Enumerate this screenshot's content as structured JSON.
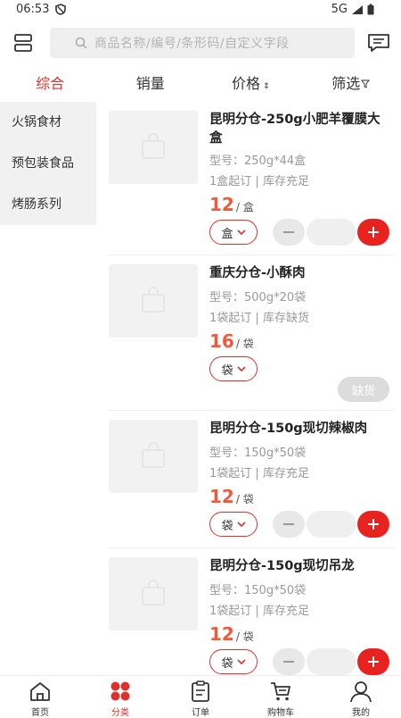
{
  "status": {
    "time": "06:53",
    "network": "5G"
  },
  "search": {
    "placeholder": "商品名称/编号/条形码/自定义字段"
  },
  "sort_tabs": [
    "综合",
    "销量",
    "价格",
    "筛选"
  ],
  "sidebar": {
    "items": [
      "火锅食材",
      "预包装食品",
      "烤肠系列"
    ]
  },
  "products": [
    {
      "title": "昆明分仓-250g小肥羊覆膜大盒",
      "spec": "型号：250g*44盒",
      "moq": "1盒起订",
      "stock": "库存充足",
      "price": "12",
      "unit": "/ 盒",
      "unit_select": "盒",
      "out_of_stock": false
    },
    {
      "title": "重庆分仓-小酥肉",
      "spec": "型号：500g*20袋",
      "moq": "1袋起订",
      "stock": "库存缺货",
      "price": "16",
      "unit": "/ 袋",
      "unit_select": "袋",
      "out_of_stock": true,
      "oos_label": "缺货"
    },
    {
      "title": "昆明分仓-150g现切辣椒肉",
      "spec": "型号：150g*50袋",
      "moq": "1袋起订",
      "stock": "库存充足",
      "price": "12",
      "unit": "/ 袋",
      "unit_select": "袋",
      "out_of_stock": false
    },
    {
      "title": "昆明分仓-150g现切吊龙",
      "spec": "型号：150g*50袋",
      "moq": "1袋起订",
      "stock": "库存充足",
      "price": "12",
      "unit": "/ 袋",
      "unit_select": "袋",
      "out_of_stock": false
    }
  ],
  "tabbar": {
    "items": [
      "首页",
      "分类",
      "订单",
      "购物车",
      "我的"
    ]
  },
  "colors": {
    "accent": "#e0302c",
    "price": "#ee5b3b"
  }
}
